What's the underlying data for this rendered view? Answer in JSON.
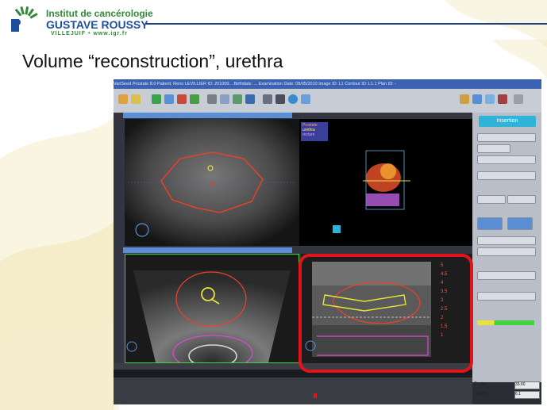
{
  "logo": {
    "line1": "Institut de cancérologie",
    "line2": "GUSTAVE ROUSSY",
    "line3": "VILLEJUIF • www.igr.fr",
    "icon": "igr-sunburst-logo"
  },
  "slide": {
    "title": "Volume “reconstruction”, urethra"
  },
  "screen": {
    "titlebar": "VariSeed Prostate 8.0  Patient: Reno LEVILLIER  ID: 201009...  Birthdate: ...  Examination Date: 08/05/2010  Image ID: L1  Contour ID: L1.1  Plan ID: -",
    "legend": [
      "Prostate",
      "urethra",
      "rectum"
    ],
    "insertion_label": "Insertion",
    "scale_labels": [
      "5",
      "4.5",
      "4",
      "3.5",
      "3",
      "2.5",
      "2",
      "1.5",
      "1"
    ],
    "bottom_fields": [
      {
        "label": "Probe:",
        "value": "33.60"
      },
      {
        "label": "Depth:",
        "value": "6.1"
      }
    ]
  },
  "colors": {
    "accent_red": "#e3131b",
    "rule_blue": "#1f3f7a",
    "logo_green": "#2f8a3a",
    "logo_blue": "#1c4f9c"
  }
}
